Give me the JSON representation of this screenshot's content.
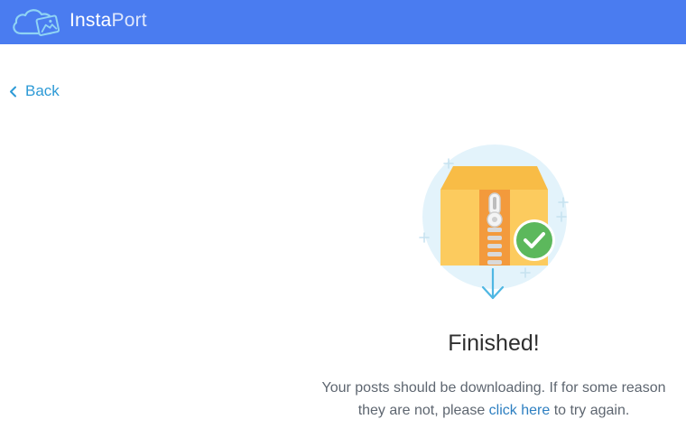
{
  "header": {
    "brand_prefix": "Insta",
    "brand_suffix": "Port",
    "background_color": "#4a7cf0"
  },
  "nav": {
    "back_label": "Back"
  },
  "status": {
    "title": "Finished!",
    "message_line1": "Your posts should be downloading. If for some reason",
    "message_line2_before": "they are not, please ",
    "link_text": "click here",
    "message_line2_after": " to try again.",
    "accent_color": "#2d9ad6",
    "success_color": "#5cb85c"
  },
  "icons": {
    "logo": "cloud-image-icon",
    "back": "chevron-left-icon",
    "illustration": "zip-archive-icon",
    "success": "checkmark-icon",
    "download": "arrow-down-icon"
  }
}
